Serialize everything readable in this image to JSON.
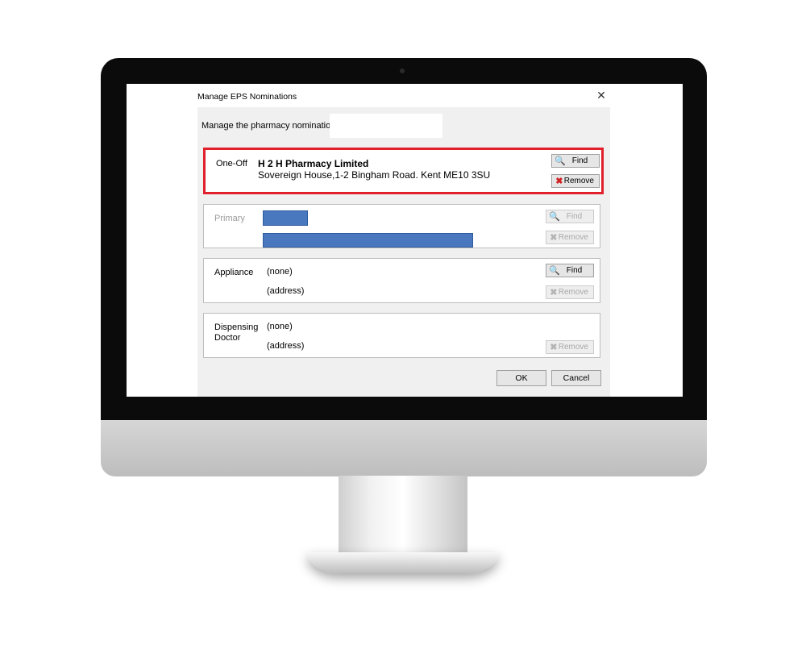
{
  "dialog": {
    "title": "Manage EPS Nominations",
    "close_glyph": "✕",
    "manage_label": "Manage the pharmacy nominations for",
    "patient_name": ""
  },
  "one_off": {
    "label": "One-Off",
    "pharmacy_name": "H 2 H Pharmacy Limited",
    "pharmacy_address": "Sovereign House,1-2 Bingham Road. Kent ME10 3SU",
    "find_label": "Find",
    "remove_label": "Remove"
  },
  "primary": {
    "label": "Primary",
    "find_label": "Find",
    "remove_label": "Remove"
  },
  "appliance": {
    "label": "Appliance",
    "name": "(none)",
    "address": "(address)",
    "find_label": "Find",
    "remove_label": "Remove"
  },
  "dispensing_doctor": {
    "label_line1": "Dispensing",
    "label_line2": "Doctor",
    "name": "(none)",
    "address": "(address)",
    "remove_label": "Remove"
  },
  "footer": {
    "ok_label": "OK",
    "cancel_label": "Cancel"
  },
  "icons": {
    "find": "🔍",
    "remove": "✖"
  },
  "colors": {
    "highlight_border": "#e0202b",
    "redaction": "#4a78bf",
    "remove_icon": "#d02020"
  }
}
